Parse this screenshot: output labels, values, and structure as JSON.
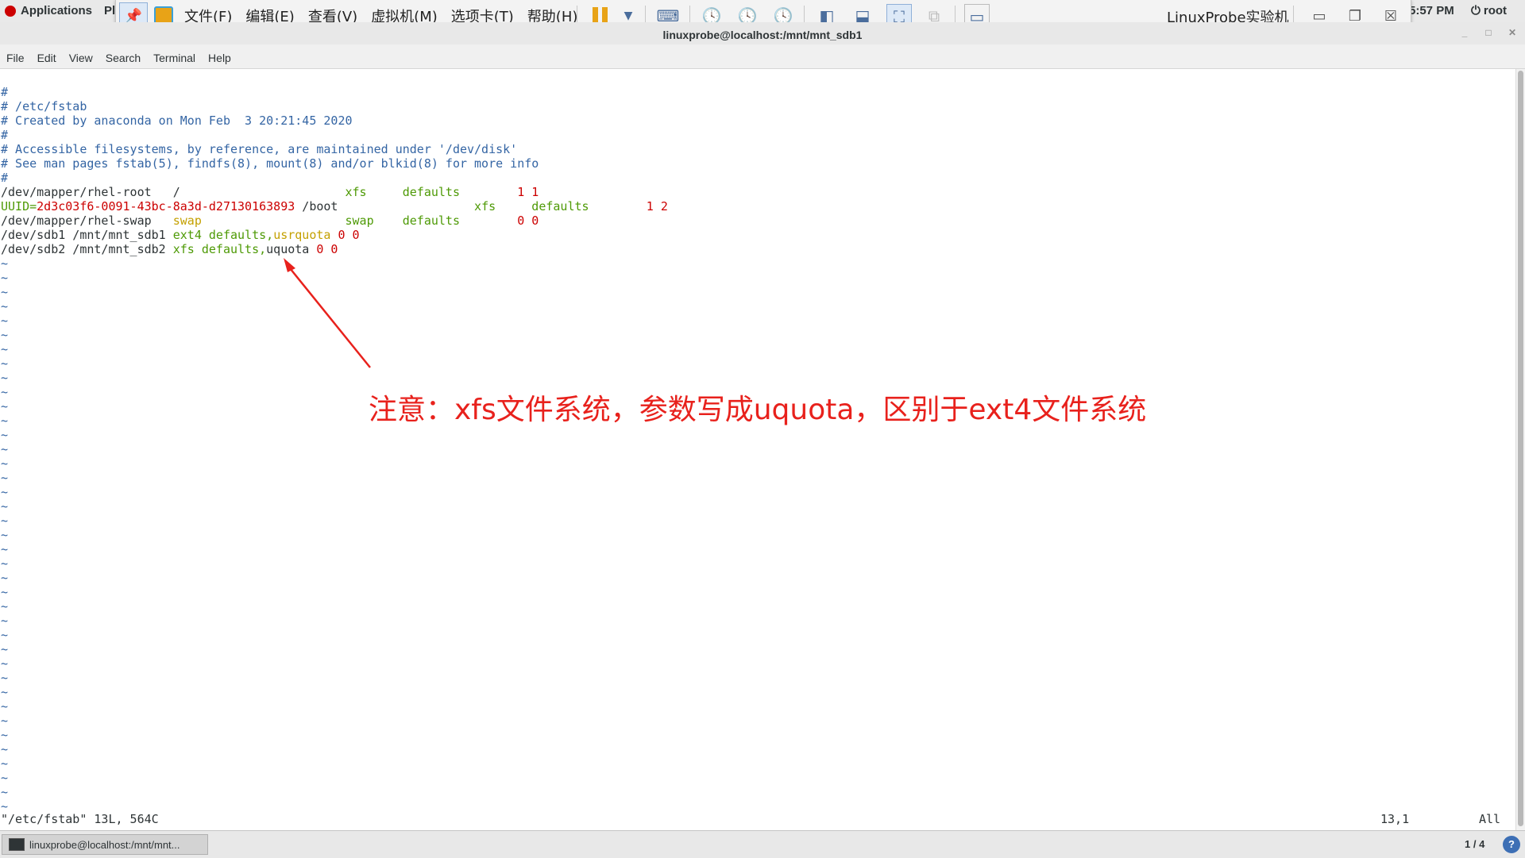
{
  "topbar": {
    "applications": "Applications",
    "places": "Pl",
    "clock": "5:57 PM",
    "user": "root"
  },
  "vmware": {
    "menus": [
      "文件(F)",
      "编辑(E)",
      "查看(V)",
      "虚拟机(M)",
      "选项卡(T)",
      "帮助(H)"
    ],
    "title": "LinuxProbe实验机"
  },
  "terminal": {
    "title": "linuxprobe@localhost:/mnt/mnt_sdb1",
    "menu": [
      "File",
      "Edit",
      "View",
      "Search",
      "Terminal",
      "Help"
    ]
  },
  "file_lines": [
    [
      {
        "t": "#",
        "c": "com"
      }
    ],
    [
      {
        "t": "# /etc/fstab",
        "c": "com"
      }
    ],
    [
      {
        "t": "# Created by anaconda on Mon Feb  3 20:21:45 2020",
        "c": "com"
      }
    ],
    [
      {
        "t": "#",
        "c": "com"
      }
    ],
    [
      {
        "t": "# Accessible filesystems, by reference, are maintained under '/dev/disk'",
        "c": "com"
      }
    ],
    [
      {
        "t": "# See man pages fstab(5), findfs(8), mount(8) and/or blkid(8) for more info",
        "c": "com"
      }
    ],
    [
      {
        "t": "#",
        "c": "com"
      }
    ],
    [
      {
        "t": "/dev/mapper/rhel-root   /                       ",
        "c": ""
      },
      {
        "t": "xfs     defaults        ",
        "c": "grn"
      },
      {
        "t": "1 1",
        "c": "red"
      }
    ],
    [
      {
        "t": "UUID=",
        "c": "grn"
      },
      {
        "t": "2d3c03f6-0091-43bc-8a3d-d27130163893",
        "c": "red"
      },
      {
        "t": " /boot                   ",
        "c": ""
      },
      {
        "t": "xfs     defaults        ",
        "c": "grn"
      },
      {
        "t": "1 2",
        "c": "red"
      }
    ],
    [
      {
        "t": "/dev/mapper/rhel-swap   ",
        "c": ""
      },
      {
        "t": "swap",
        "c": "org"
      },
      {
        "t": "                    ",
        "c": ""
      },
      {
        "t": "swap    defaults        ",
        "c": "grn"
      },
      {
        "t": "0 0",
        "c": "red"
      }
    ],
    [
      {
        "t": "/dev/sdb1 /mnt/mnt_sdb1 ",
        "c": ""
      },
      {
        "t": "ext4 defaults,",
        "c": "grn"
      },
      {
        "t": "usrquota",
        "c": "org"
      },
      {
        "t": " ",
        "c": ""
      },
      {
        "t": "0 0",
        "c": "red"
      }
    ],
    [
      {
        "t": "/dev/sdb2 /mnt/mnt_sdb2 ",
        "c": ""
      },
      {
        "t": "xfs defaults,",
        "c": "grn"
      },
      {
        "t": "uquota",
        "c": ""
      },
      {
        "t": " ",
        "c": ""
      },
      {
        "t": "0 0",
        "c": "red"
      }
    ]
  ],
  "tilde": "~",
  "tilde_count": 39,
  "status": {
    "file_info": "\"/etc/fstab\" 13L, 564C",
    "position": "13,1",
    "scroll": "All"
  },
  "taskbar": {
    "task_label": "linuxprobe@localhost:/mnt/mnt...",
    "workspace": "1 / 4",
    "help": "?"
  },
  "annotation": "注意：xfs文件系统，参数写成uquota，区别于ext4文件系统"
}
